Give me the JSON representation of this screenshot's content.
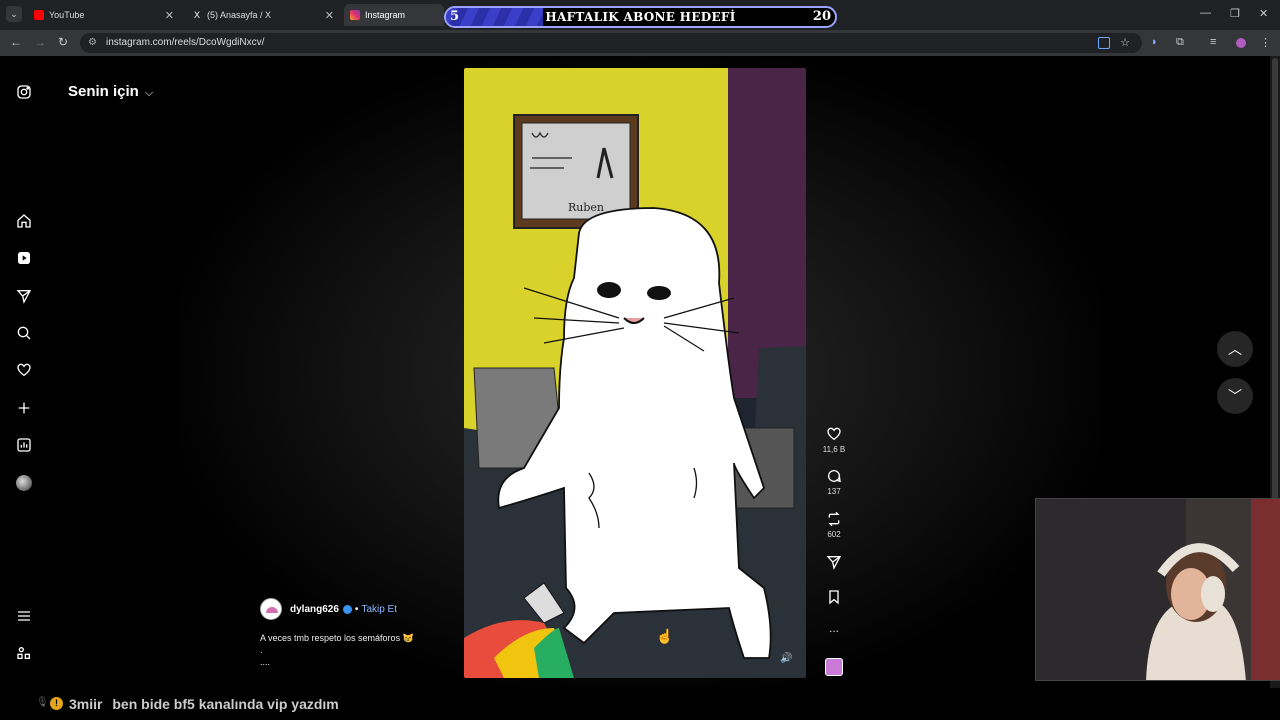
{
  "browser": {
    "tabs": [
      {
        "title": "YouTube",
        "favicon": "youtube-icon",
        "color": "#ff0000"
      },
      {
        "title": "(5) Anasayfa / X",
        "favicon": "x-icon",
        "color": "#ffffff"
      },
      {
        "title": "Instagram",
        "favicon": "instagram-icon",
        "color": "#e1306c"
      }
    ],
    "url": "instagram.com/reels/DcoWgdiNxcv/"
  },
  "goal_widget": {
    "current": "5",
    "title": "HAFTALIK ABONE HEDEFİ",
    "target": "20",
    "progress_fraction": 0.25,
    "accent": "#9aa3ff"
  },
  "instagram": {
    "feed_label": "Senin için",
    "sidebar_icons": [
      "instagram-icon",
      "home-icon",
      "reels-icon",
      "send-icon",
      "search-icon",
      "heart-icon",
      "create-icon",
      "insights-icon",
      "profile-avatar",
      "menu-icon",
      "meta-apps-icon"
    ],
    "reel": {
      "author": "dylang626",
      "follow_label": "Takip Et",
      "separator": "•",
      "caption_line1": "A veces tmb respeto los semáforos 😿",
      "caption_line2": ".",
      "caption_more": "....",
      "painting_text": "Ruben",
      "actions": [
        {
          "icon": "heart-icon",
          "count": "11,6 B"
        },
        {
          "icon": "comment-icon",
          "count": "137"
        },
        {
          "icon": "repost-icon",
          "count": "602"
        },
        {
          "icon": "send-icon",
          "count": ""
        },
        {
          "icon": "bookmark-icon",
          "count": ""
        },
        {
          "icon": "more-icon",
          "count": "..."
        }
      ]
    }
  },
  "stream_chat": {
    "user": "3miir",
    "message": "ben bide bf5 kanalında vip yazdım",
    "badge": "!"
  }
}
